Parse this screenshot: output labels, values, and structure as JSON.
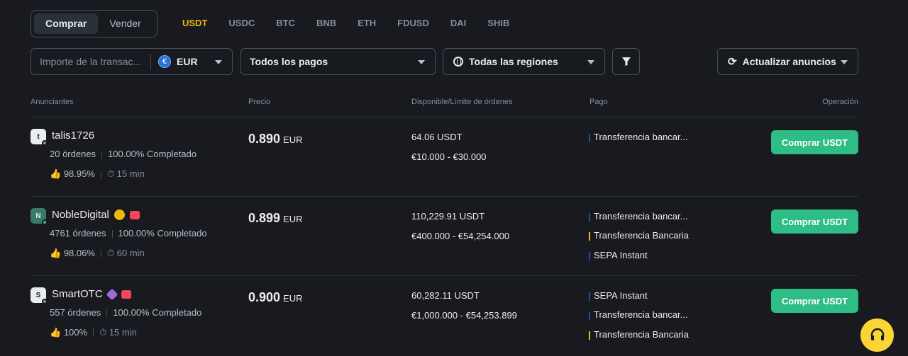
{
  "trade_toggle": {
    "buy": "Comprar",
    "sell": "Vender"
  },
  "coins": [
    "USDT",
    "USDC",
    "BTC",
    "BNB",
    "ETH",
    "FDUSD",
    "DAI",
    "SHIB"
  ],
  "filters": {
    "amount_placeholder": "Importe de la transac...",
    "currency": "EUR",
    "currency_icon": "€",
    "payments": "Todos los pagos",
    "regions": "Todas las regiones",
    "refresh": "Actualizar anuncios"
  },
  "table": {
    "headers": [
      "Anunciantes",
      "Precio",
      "Disponible/Límite de órdenes",
      "Pago",
      "Operación"
    ],
    "rows": [
      {
        "avatar": "t",
        "name": "talis1726",
        "orders": "20 órdenes",
        "completion": "100.00% Completado",
        "rating": "98.95%",
        "time": "15 min",
        "price": "0.890",
        "price_unit": "EUR",
        "available": "64.06 USDT",
        "limit": "€10.000 - €30.000",
        "payments": [
          "Transferencia bancar..."
        ],
        "button": "Comprar USDT"
      },
      {
        "avatar": "N",
        "name": "NobleDigital",
        "orders": "4761 órdenes",
        "completion": "100.00% Completado",
        "rating": "98.06%",
        "time": "60 min",
        "price": "0.899",
        "price_unit": "EUR",
        "available": "110,229.91 USDT",
        "limit": "€400.000 - €54,254.000",
        "payments": [
          "Transferencia bancar...",
          "Transferencia Bancaria",
          "SEPA Instant"
        ],
        "button": "Comprar USDT"
      },
      {
        "avatar": "S",
        "name": "SmartOTC",
        "orders": "557 órdenes",
        "completion": "100.00% Completado",
        "rating": "100%",
        "time": "15 min",
        "price": "0.900",
        "price_unit": "EUR",
        "available": "60,282.11 USDT",
        "limit": "€1,000.000 - €54,253.899",
        "payments": [
          "SEPA Instant",
          "Transferencia bancar...",
          "Transferencia Bancaria"
        ],
        "button": "Comprar USDT"
      }
    ]
  },
  "colors": {
    "accent": "#f0b90b",
    "buy": "#2ebd85",
    "bg": "#181a20"
  }
}
